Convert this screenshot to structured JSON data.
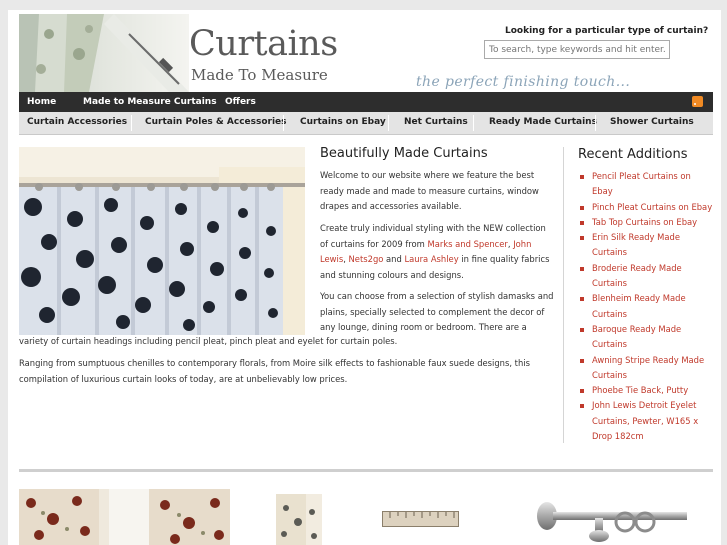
{
  "header": {
    "logo_title": "Curtains",
    "logo_subtitle": "Made To Measure",
    "tagline": "the perfect finishing touch...",
    "search_label": "Looking for a particular type of curtain?",
    "search_placeholder": "To search, type keywords and hit enter..."
  },
  "nav_primary": [
    "Home",
    "Made to Measure Curtains",
    "Offers"
  ],
  "nav_secondary": [
    "Curtain Accessories",
    "Curtain Poles & Accessories",
    "Curtains on Ebay",
    "Net Curtains",
    "Ready Made Curtains",
    "Shower Curtains"
  ],
  "content": {
    "title": "Beautifully Made Curtains",
    "p1": "Welcome to our website where we feature the best ready made and made to measure curtains, window drapes and accessories available.",
    "p2_before": "Create truly individual styling with the NEW collection of curtains for 2009 from ",
    "link_marks": "Marks and Spencer",
    "p2_comma1": ", ",
    "link_lewis": "John Lewis",
    "p2_comma2": ", ",
    "link_nets": "Nets2go",
    "p2_and": " and ",
    "link_laura": "Laura Ashley",
    "p2_after": " in fine quality fabrics and stunning colours and designs.",
    "p3a": "You can choose from a selection of stylish damasks and plains, specially selected to complement the decor of any lounge, dining room or bedroom. There are a",
    "p3b": "variety of curtain headings including pencil pleat, pinch pleat and eyelet for curtain poles.",
    "p4": "Ranging from sumptuous chenilles to contemporary florals, from Moire silk effects to fashionable faux suede designs, this compilation of luxurious curtain looks of today, are at unbelievably low prices."
  },
  "sidebar": {
    "title": "Recent Additions",
    "items": [
      "Pencil Pleat Curtains on Ebay",
      "Pinch Pleat Curtains on Ebay",
      "Tab Top Curtains on Ebay",
      "Erin Silk Ready Made Curtains",
      "Broderie Ready Made Curtains",
      "Blenheim Ready Made Curtains",
      "Baroque Ready Made Curtains",
      "Awning Stripe Ready Made Curtains",
      "Phoebe Tie Back, Putty",
      "John Lewis Detroit Eyelet Curtains, Pewter, W165 x Drop 182cm"
    ]
  },
  "colors": {
    "link": "#c0392b",
    "nav_dark": "#2d2d2d",
    "nav_light": "#e4e4e4",
    "rss": "#f08a24"
  }
}
